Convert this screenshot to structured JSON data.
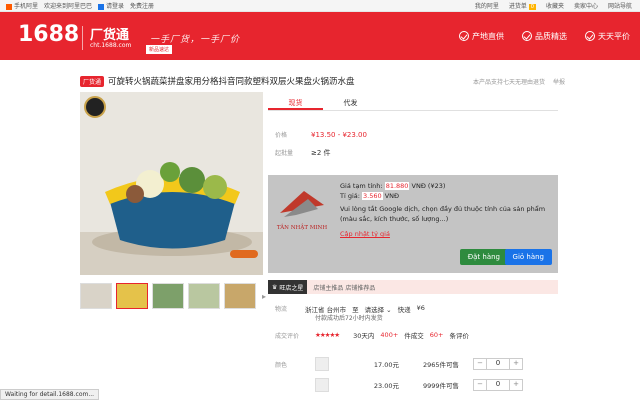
{
  "topbar": {
    "mobile": "手机阿里",
    "welcome": "欢迎来到阿里巴巴",
    "login": "请登录",
    "register": "免费注册",
    "right_items": [
      "我的阿里",
      "进货单",
      "0",
      "收藏夹",
      "卖家中心",
      "网站导航"
    ]
  },
  "header": {
    "logo": "1688",
    "sub": "厂货通",
    "url": "cht.1688.com",
    "slogan": "一手厂货，一手厂价",
    "tag": "新品速达",
    "nav": [
      "产地直供",
      "品质精选",
      "天天平价"
    ]
  },
  "product": {
    "store_tag": "厂货通",
    "title": "可旋转火锅蔬菜拼盘家用分格抖音同款塑料双层火果盘火锅沥水盘",
    "actions": [
      "本产品支持七天无理由退货",
      "举报"
    ],
    "tabs": [
      "现货",
      "代发"
    ],
    "price_label": "价格",
    "price": "¥13.50 - ¥23.00",
    "moq_label": "起批量",
    "moq": "≥2 件"
  },
  "overlay": {
    "brand": "TÂN NHẬT MINH",
    "line1_pre": "Giá tạm tính:",
    "line1_hl": "81.880",
    "line1_post": "VNĐ (¥23)",
    "line2_pre": "Tỉ giá:",
    "line2_hl": "3.560",
    "line2_post": "VNĐ",
    "line3": "Vui lòng tắt Google dịch, chọn đầy đủ thuộc tính của sản phẩm",
    "line4": "(màu sắc, kích thước, số lượng...)",
    "link": "Cập nhật tỷ giá",
    "order_btn": "Đặt hàng",
    "cart_btn": "Giỏ hàng"
  },
  "shop": {
    "tag": "旺店之星",
    "text": "店铺主推品 店铺推荐品"
  },
  "shipping": {
    "label": "物流",
    "from": "浙江省 台州市",
    "to_label": "至",
    "to": "请选择",
    "method": "快递",
    "fee": "¥6",
    "sub": "付款成功后72小时内发货"
  },
  "stats": {
    "label": "成交评价",
    "stars": "★★★★★",
    "days": "30天内",
    "count": "400+",
    "deal_word": "件成交",
    "reviews": "60+",
    "reviews_word": "条评价"
  },
  "variants": {
    "label": "颜色",
    "rows": [
      {
        "price": "17.00元",
        "stock": "2965件可售",
        "qty": "0"
      },
      {
        "price": "23.00元",
        "stock": "9999件可售",
        "qty": "0"
      }
    ]
  },
  "status": "Waiting for detail.1688.com..."
}
